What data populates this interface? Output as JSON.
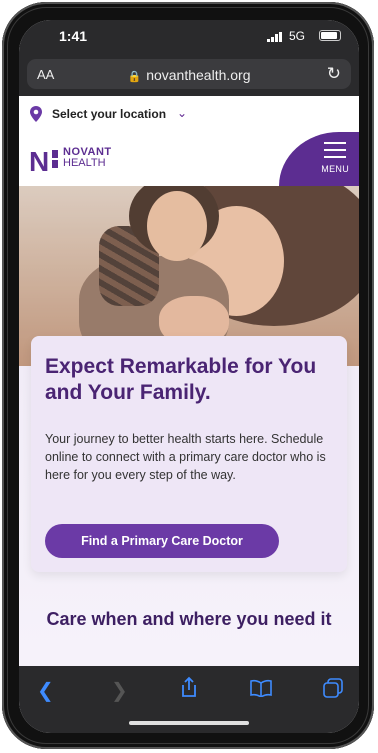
{
  "status_bar": {
    "time": "1:41",
    "network": "5G"
  },
  "browser": {
    "aa_label": "AA",
    "url": "novanthealth.org"
  },
  "location": {
    "label": "Select your location"
  },
  "header": {
    "logo_line1": "NOVANT",
    "logo_line2": "HEALTH",
    "menu_label": "MENU"
  },
  "hero": {
    "title": "Expect Remarkable for You and Your Family.",
    "body": "Your journey to better health starts here. Schedule online to connect with a primary care doctor who is here for you every step of the way.",
    "cta_label": "Find a Primary Care Doctor"
  },
  "section": {
    "heading": "Care when and where you need it"
  },
  "colors": {
    "brand_purple": "#5c2d91",
    "cta_purple": "#6b3aa6",
    "safari_blue": "#3e8bff"
  },
  "toolbar": {
    "icons": [
      "back-icon",
      "forward-icon",
      "share-icon",
      "bookmarks-icon",
      "tabs-icon"
    ]
  }
}
